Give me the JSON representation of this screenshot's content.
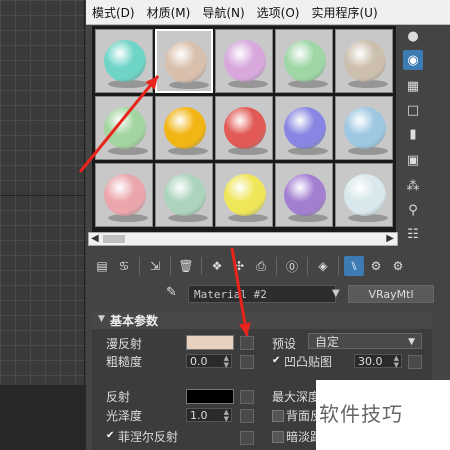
{
  "menu": [
    "模式(D)",
    "材质(M)",
    "导航(N)",
    "选项(O)",
    "实用程序(U)"
  ],
  "slots": [
    {
      "color": "#6dd4c6",
      "selected": false
    },
    {
      "color": "#d9c0ad",
      "selected": true
    },
    {
      "color": "#d8a8dc",
      "selected": false
    },
    {
      "color": "#9ed6a6",
      "selected": false
    },
    {
      "color": "#cdbfae",
      "selected": false
    },
    {
      "color": "#a3d5a0",
      "selected": false
    },
    {
      "color": "#f1b514",
      "selected": false
    },
    {
      "color": "#e25a55",
      "selected": false
    },
    {
      "color": "#8786e2",
      "selected": false
    },
    {
      "color": "#9ec8e2",
      "selected": false
    },
    {
      "color": "#eba6ac",
      "selected": false
    },
    {
      "color": "#acd4bd",
      "selected": false
    },
    {
      "color": "#f0e65a",
      "selected": false
    },
    {
      "color": "#a37fd2",
      "selected": false
    },
    {
      "color": "#d8e8ec",
      "selected": false
    }
  ],
  "material": {
    "name": "Material #2",
    "type": "VRayMtl"
  },
  "rollout": {
    "title": "基本参数",
    "diffuse_label": "漫反射",
    "diffuse_color": "#e9d1c0",
    "preset_label": "预设",
    "preset_value": "自定",
    "roughness_label": "粗糙度",
    "roughness_value": "0.0",
    "bump_label": "凹凸贴图",
    "bump_value": "30.0",
    "reflect_label": "反射",
    "reflect_color": "#000000",
    "max_depth_label": "最大深度",
    "gloss_label": "光泽度",
    "gloss_value": "1.0",
    "backface_label": "背面反",
    "fresnel_label": "菲涅尔反射",
    "dim_label": "暗淡距"
  },
  "watermark": "软件技巧",
  "annotation_color": "#e8241c"
}
